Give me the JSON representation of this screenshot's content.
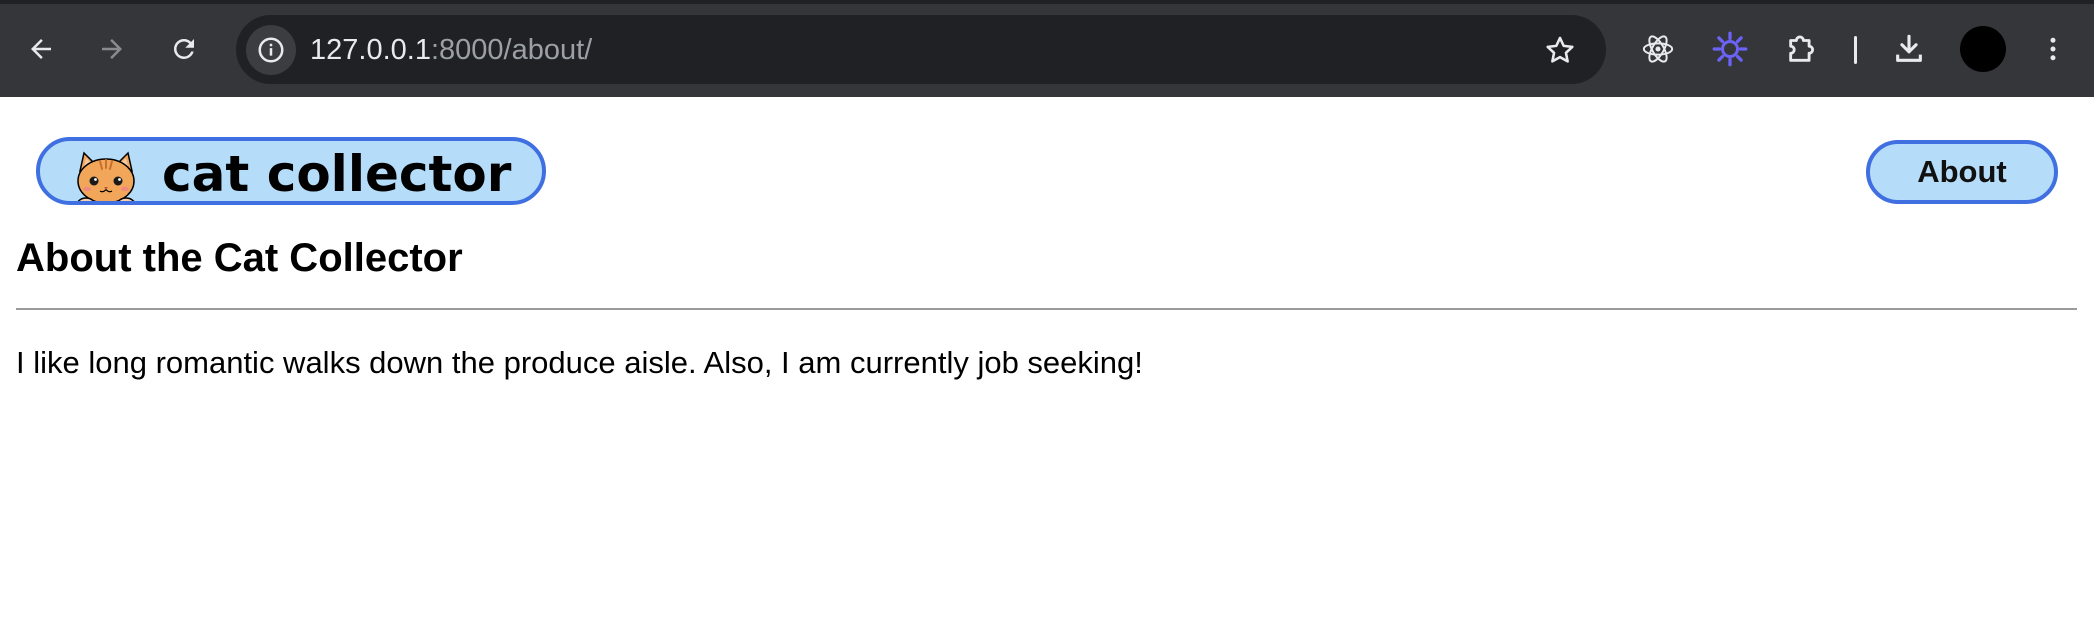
{
  "browser": {
    "url_host": "127.0.0.1",
    "url_rest": ":8000/about/",
    "icons": {
      "back": "arrow-left-icon",
      "forward": "arrow-right-icon",
      "reload": "reload-icon",
      "site_info": "info-icon",
      "bookmark": "star-icon",
      "extension_1": "react-atom-icon",
      "extension_2": "purple-sunburst-icon",
      "extensions": "puzzle-piece-icon",
      "download": "download-icon",
      "menu": "kebab-menu-icon"
    }
  },
  "site": {
    "logo_text": "cat collector",
    "nav": {
      "about_label": "About"
    }
  },
  "main": {
    "title": "About the Cat Collector",
    "body": "I like long romantic walks down the produce aisle. Also, I am currently job seeking!"
  },
  "colors": {
    "chrome_bg": "#35363a",
    "omnibox_bg": "#202124",
    "pill_fill": "#b5dcf8",
    "pill_border": "#3f6fe0",
    "extension_accent": "#6b63f5"
  }
}
